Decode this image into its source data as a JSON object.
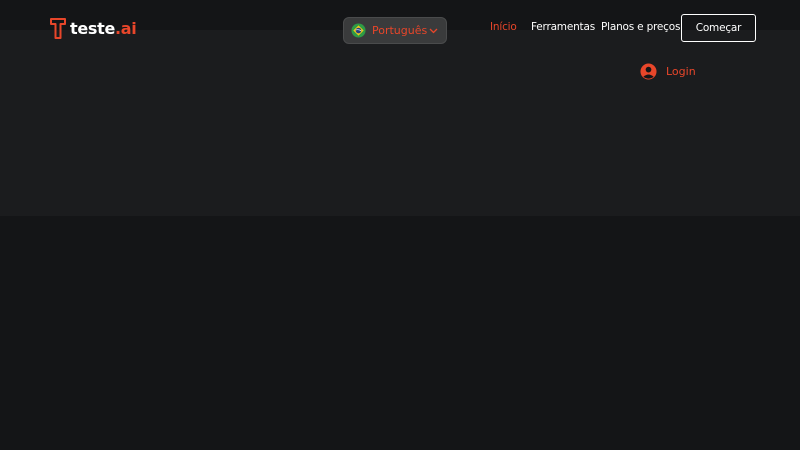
{
  "brand": {
    "name_main": "teste",
    "name_accent": ".ai",
    "accent_color": "#e8462a",
    "logo_icon": "t-logo-icon"
  },
  "language_selector": {
    "selected": "Português",
    "flag_icon": "brazil-flag-icon",
    "chevron_icon": "chevron-down-icon"
  },
  "nav": {
    "items": [
      {
        "label": "Início",
        "active": true
      },
      {
        "label": "Ferramentas",
        "active": false
      },
      {
        "label": "Planos e preços",
        "active": false
      }
    ],
    "cta_label": "Começar"
  },
  "login": {
    "label": "Login",
    "icon": "user-circle-icon"
  },
  "colors": {
    "background": "#141517",
    "hero_band": "#1b1c1e",
    "accent": "#e8462a"
  }
}
